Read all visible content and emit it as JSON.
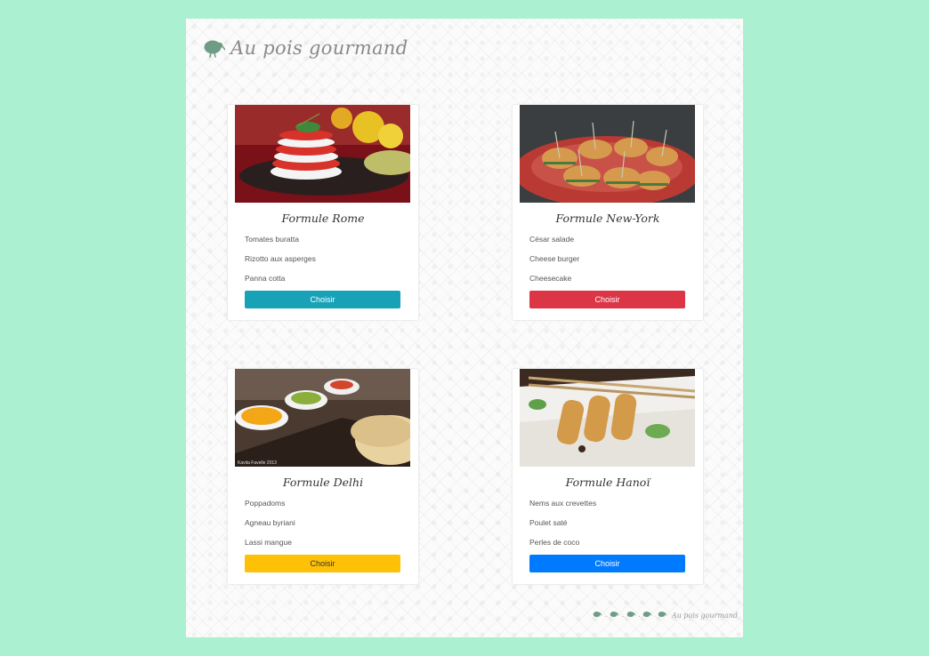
{
  "brand": {
    "title": "Au pois gourmand",
    "logo_icon": "kiwi-icon"
  },
  "cards": [
    {
      "title": "Formule Rome",
      "items": [
        "Tomates buratta",
        "Rizotto aux asperges",
        "Panna cotta"
      ],
      "button_label": "Choisir",
      "button_color": "#17a2b8",
      "button_text_color": "#ffffff",
      "image": "tomato-mozzarella-stack-image"
    },
    {
      "title": "Formule New-York",
      "items": [
        "César salade",
        "Cheese burger",
        "Cheesecake"
      ],
      "button_label": "Choisir",
      "button_color": "#dc3545",
      "button_text_color": "#ffffff",
      "image": "mini-burgers-image"
    },
    {
      "title": "Formule Delhi",
      "items": [
        "Poppadoms",
        "Agneau byriani",
        "Lassi mangue"
      ],
      "button_label": "Choisir",
      "button_color": "#ffc107",
      "button_text_color": "#333333",
      "image": "chutney-spoons-image",
      "image_caption": "Kavita Favelle 2013"
    },
    {
      "title": "Formule Hanoï",
      "items": [
        "Nems aux crevettes",
        "Poulet saté",
        "Perles de coco"
      ],
      "button_label": "Choisir",
      "button_color": "#007bff",
      "button_text_color": "#ffffff",
      "image": "spring-rolls-image"
    }
  ],
  "footer": {
    "text": "Au pois gourmand",
    "icon": "kiwi-icon"
  },
  "colors": {
    "background": "#aaf0d1",
    "kiwi": "#6f9c85"
  }
}
